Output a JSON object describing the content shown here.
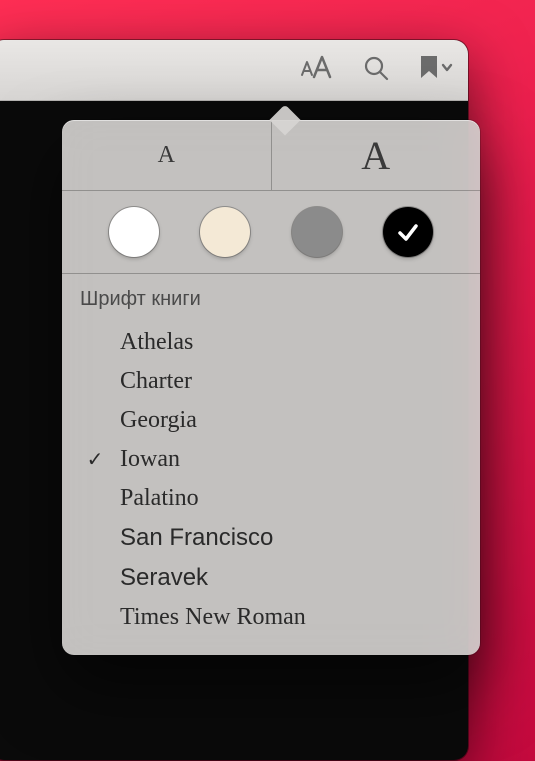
{
  "toolbar": {
    "appearance_icon": "text-appearance-icon",
    "search_icon": "search-icon",
    "bookmark_icon": "bookmark-dropdown-icon"
  },
  "popover": {
    "size": {
      "small_label": "A",
      "large_label": "A"
    },
    "themes": [
      {
        "id": "white",
        "color": "#ffffff",
        "selected": false
      },
      {
        "id": "sepia",
        "color": "#f4e9d6",
        "selected": false
      },
      {
        "id": "gray",
        "color": "#8b8b8b",
        "selected": false
      },
      {
        "id": "night",
        "color": "#000000",
        "selected": true
      }
    ],
    "fonts_header": "Шрифт книги",
    "fonts": [
      {
        "name": "Athelas",
        "css": "Georgia, 'Times New Roman', serif",
        "selected": false
      },
      {
        "name": "Charter",
        "css": "Georgia, 'Times New Roman', serif",
        "selected": false
      },
      {
        "name": "Georgia",
        "css": "Georgia, serif",
        "selected": false
      },
      {
        "name": "Iowan",
        "css": "Georgia, 'Times New Roman', serif",
        "selected": true
      },
      {
        "name": "Palatino",
        "css": "'Palatino Linotype', Palatino, Georgia, serif",
        "selected": false
      },
      {
        "name": "San Francisco",
        "css": "-apple-system, 'Helvetica Neue', Arial, sans-serif",
        "selected": false
      },
      {
        "name": "Seravek",
        "css": "'Segoe UI', 'Helvetica Neue', Arial, sans-serif",
        "selected": false
      },
      {
        "name": "Times New Roman",
        "css": "'Times New Roman', Times, serif",
        "selected": false
      }
    ],
    "checkmark_glyph": "✓"
  }
}
